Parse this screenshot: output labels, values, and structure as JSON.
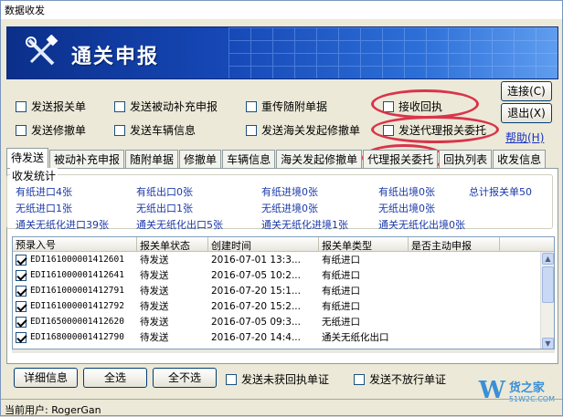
{
  "window": {
    "title": "数据收发"
  },
  "banner": {
    "title": "通关申报"
  },
  "options": {
    "send_declaration": "发送报关单",
    "send_passive_supplement": "发送被动补充申报",
    "resend_attached": "重传随附单据",
    "receive_receipt": "接收回执",
    "send_modification": "发送修撤单",
    "send_vehicle_info": "发送车辆信息",
    "send_customs_modification": "发送海关发起修撤单",
    "send_agent_entrust": "发送代理报关委托"
  },
  "buttons": {
    "connect": "连接(C)",
    "exit": "退出(X)",
    "help": "帮助(H)"
  },
  "tabs": [
    "待发送",
    "被动补充申报",
    "随附单据",
    "修撤单",
    "车辆信息",
    "海关发起修撤单",
    "代理报关委托",
    "回执列表",
    "收发信息"
  ],
  "stats": {
    "legend": "收发统计",
    "items": [
      "有纸进口4张",
      "有纸出口0张",
      "有纸进境0张",
      "有纸出境0张",
      "总计报关单50",
      "无纸进口1张",
      "无纸出口1张",
      "无纸进境0张",
      "无纸出境0张",
      "通关无纸化进口39张",
      "通关无纸化出口5张",
      "通关无纸化进境1张",
      "通关无纸化出境0张"
    ]
  },
  "table": {
    "headers": [
      "预录入号",
      "报关单状态",
      "创建时间",
      "报关单类型",
      "是否主动申报"
    ],
    "rows": [
      [
        "EDI161000001412601",
        "待发送",
        "2016-07-01 13:3...",
        "有纸进口",
        ""
      ],
      [
        "EDI161000001412641",
        "待发送",
        "2016-07-05 10:2...",
        "有纸进口",
        ""
      ],
      [
        "EDI161000001412791",
        "待发送",
        "2016-07-20 15:1...",
        "有纸进口",
        ""
      ],
      [
        "EDI161000001412792",
        "待发送",
        "2016-07-20 15:2...",
        "有纸进口",
        ""
      ],
      [
        "EDI165000001412620",
        "待发送",
        "2016-07-05 09:3...",
        "无纸进口",
        ""
      ],
      [
        "EDI168000001412790",
        "待发送",
        "2016-07-20 14:4...",
        "通关无纸化出口",
        ""
      ]
    ]
  },
  "bottom": {
    "details": "详细信息",
    "select_all": "全选",
    "select_none": "全不选",
    "send_no_receipt": "发送未获回执单证",
    "send_not_released": "发送不放行单证"
  },
  "status": {
    "current_user": "当前用户: RogerGan"
  },
  "watermark": {
    "brand": "货之家",
    "url": "51W2C.COM"
  },
  "colors": {
    "annotation": "#d9344a",
    "banner": "#1648b7",
    "link": "#1a33c4"
  }
}
